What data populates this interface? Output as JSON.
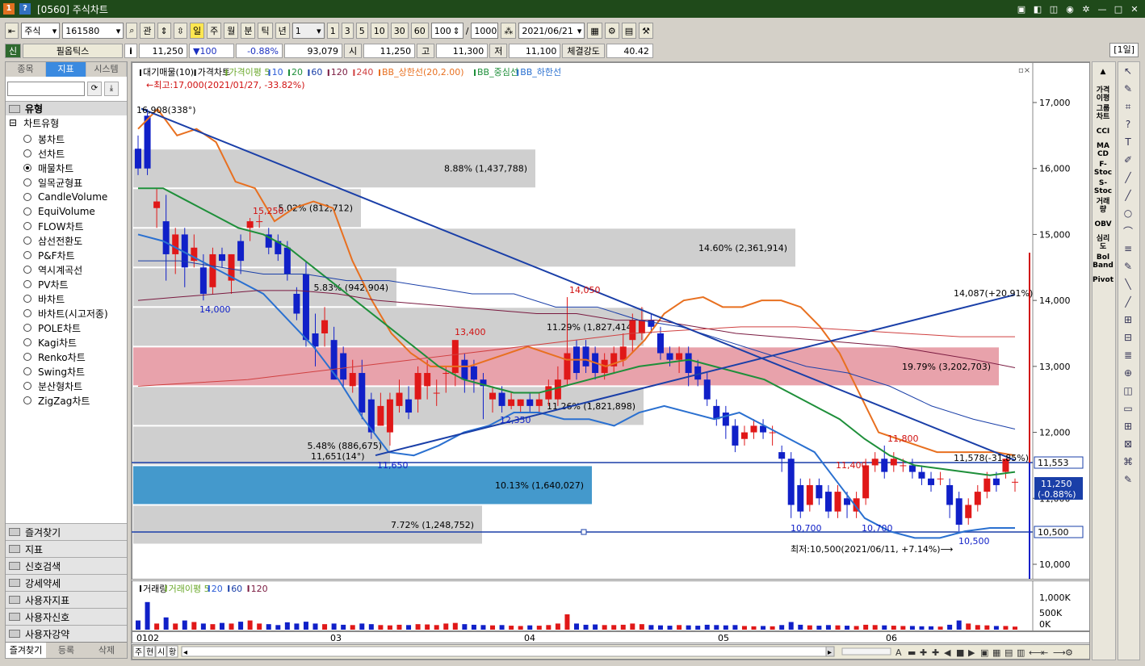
{
  "window": {
    "title": "[0560] 주식차트",
    "icon_left": "1",
    "icon_right": "?"
  },
  "toolbar": {
    "market": "주식",
    "code": "161580",
    "btn_gwan": "관",
    "periods": [
      "일",
      "주",
      "월",
      "분",
      "틱",
      "년"
    ],
    "count_select": "1",
    "intervals": [
      "1",
      "3",
      "5",
      "10",
      "30",
      "60"
    ],
    "bars": "100",
    "slash": "/",
    "total": "1000",
    "date": "2021/06/21"
  },
  "info": {
    "badge": "신",
    "name": "필옵틱스",
    "i_label": "i",
    "price": "11,250",
    "change": "▼100",
    "rate": "-0.88%",
    "volume": "93,079",
    "open_label": "시",
    "open": "11,250",
    "high_label": "고",
    "high": "11,300",
    "low_label": "저",
    "low": "11,100",
    "strength_label": "체결강도",
    "strength": "40.42",
    "period_tag": "[1일]"
  },
  "left": {
    "tabs": [
      "종목",
      "지표",
      "시스템"
    ],
    "section": "유형",
    "group": "차트유형",
    "types": [
      "봉차트",
      "선차트",
      "매물차트",
      "일목균형표",
      "CandleVolume",
      "EquiVolume",
      "FLOW차트",
      "삼선전환도",
      "P&F차트",
      "역시계곡선",
      "PV차트",
      "바차트",
      "바차트(시고저종)",
      "POLE차트",
      "Kagi차트",
      "Renko차트",
      "Swing차트",
      "분산형차트",
      "ZigZag차트"
    ],
    "selected_type": "매물차트",
    "bottom": [
      "즐겨찾기",
      "지표",
      "신호검색",
      "강세약세",
      "사용자지표",
      "사용자신호",
      "사용자강약"
    ],
    "actions": [
      "즐겨찾기",
      "등록",
      "삭제"
    ]
  },
  "legend": {
    "items": [
      {
        "t": "대기매물(10)",
        "c": "#000000"
      },
      {
        "t": "가격차트",
        "c": "#000000"
      },
      {
        "t": "가격이평 5",
        "c": "#6aa82a"
      },
      {
        "t": "10",
        "c": "#2a5bd7"
      },
      {
        "t": "20",
        "c": "#1e8f3a"
      },
      {
        "t": "60",
        "c": "#1a3fa8"
      },
      {
        "t": "120",
        "c": "#7a1a40"
      },
      {
        "t": "240",
        "c": "#d04040"
      },
      {
        "t": "BB_상한선(20,2.00)",
        "c": "#e87020"
      },
      {
        "t": "BB_중심선",
        "c": "#1e8f3a"
      },
      {
        "t": "BB_하한선",
        "c": "#2a70d0"
      }
    ],
    "high_note": "←최고:17,000(2021/01/27, -33.82%)"
  },
  "price_axis": [
    "17,000",
    "16,000",
    "15,000",
    "14,000",
    "13,000",
    "12,000",
    "11,000",
    "10,000"
  ],
  "price_marks": {
    "last": "11,553",
    "cur": "11,250",
    "cur_rate": "(-0.88%)",
    "low_line": "10,500"
  },
  "volume_profile": [
    {
      "label": "8.88% (1,437,788)",
      "p": "16000"
    },
    {
      "label": "5.02% (812,712)",
      "p": "15400"
    },
    {
      "label": "14.60% (2,361,914)",
      "p": "14800"
    },
    {
      "label": "5.83% (942,904)",
      "p": "14200"
    },
    {
      "label": "11.29% (1,827,414)",
      "p": "13600"
    },
    {
      "label": "19.79% (3,202,703)",
      "p": "13000"
    },
    {
      "label": "11.26% (1,821,898)",
      "p": "12400"
    },
    {
      "label": "5.48% (886,675)",
      "p": "11800"
    },
    {
      "label": "10.13% (1,640,027)",
      "p": "11200"
    },
    {
      "label": "7.72% (1,248,752)",
      "p": "10600"
    }
  ],
  "annotations": {
    "trend_start": "16,908(338°)",
    "trend_left": "11,651(14°)",
    "trend_right": "14,087(+20.91%)",
    "trend_right2": "11,578(-31.85%)",
    "low_note": "최저:10,500(2021/06/11, +7.14%)⟶",
    "peaks": [
      "15,250",
      "13,400",
      "14,050",
      "11,800",
      "11,400"
    ],
    "troughs": [
      "14,000",
      "12,350",
      "11,650",
      "10,700",
      "10,700",
      "10,500"
    ]
  },
  "volume_panel": {
    "legend": [
      {
        "t": "거래량",
        "c": "#000000"
      },
      {
        "t": "거래이평 5",
        "c": "#6aa82a"
      },
      {
        "t": "20",
        "c": "#2a5bd7"
      },
      {
        "t": "60",
        "c": "#1a3fa8"
      },
      {
        "t": "120",
        "c": "#7a1a40"
      }
    ],
    "axis": [
      "1,000K",
      "500K",
      "0K"
    ]
  },
  "months": [
    "01",
    "02",
    "03",
    "04",
    "05",
    "06"
  ],
  "bottom_tabs": [
    "주",
    "현",
    "시",
    "황"
  ],
  "right_tools": [
    "가격\n이평",
    "그룹\n차트",
    "CCI",
    "MA\nCD",
    "F-\nStoc",
    "S-\nStoc",
    "거래\n량",
    "OBV",
    "심리\n도",
    "Bol\nBand",
    "Pivot"
  ]
}
